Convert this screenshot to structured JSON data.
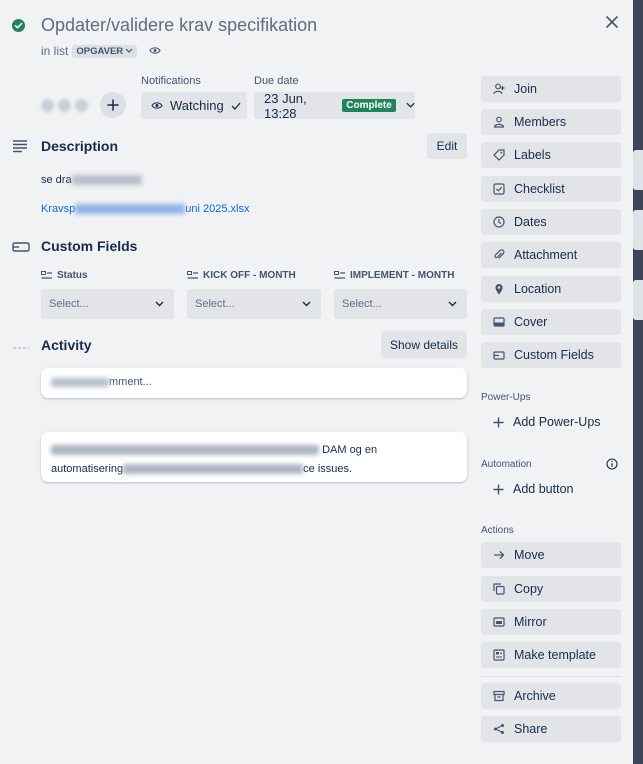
{
  "card": {
    "title": "Opdater/validere krav specifikation",
    "in_list_prefix": "in list",
    "list_name": "OPGAVER"
  },
  "labels": {
    "notifications": "Notifications",
    "due_date": "Due date"
  },
  "watch_label": "Watching",
  "due": {
    "value": "23 Jun, 13:28",
    "status": "Complete",
    "status_color": "#1f845a"
  },
  "description": {
    "heading": "Description",
    "edit_label": "Edit",
    "text": "se dra",
    "attachment_link": "Kravsp",
    "attachment_link_end": "uni 2025.xlsx"
  },
  "custom_fields": {
    "heading": "Custom Fields",
    "fields": [
      {
        "label": "Status",
        "placeholder": "Select..."
      },
      {
        "label": "KICK OFF - MONTH",
        "placeholder": "Select..."
      },
      {
        "label": "IMPLEMENT - MONTH",
        "placeholder": "Select..."
      }
    ]
  },
  "activity": {
    "heading": "Activity",
    "show_details_label": "Show details",
    "comment_placeholder": "mment...",
    "comment_line1_end": "DAM og en",
    "comment_line2_start": "automatisering",
    "comment_line2_end": "ce issues."
  },
  "sidebar": {
    "top": [
      {
        "label": "Join",
        "icon": "join-icon"
      },
      {
        "label": "Members",
        "icon": "person-icon"
      },
      {
        "label": "Labels",
        "icon": "tag-icon"
      },
      {
        "label": "Checklist",
        "icon": "checklist-icon"
      },
      {
        "label": "Dates",
        "icon": "clock-icon"
      },
      {
        "label": "Attachment",
        "icon": "paperclip-icon"
      },
      {
        "label": "Location",
        "icon": "pin-icon"
      },
      {
        "label": "Cover",
        "icon": "cover-icon"
      },
      {
        "label": "Custom Fields",
        "icon": "custom-fields-icon"
      }
    ],
    "powerups_heading": "Power-Ups",
    "add_powerups_label": "Add Power-Ups",
    "automation_heading": "Automation",
    "add_button_label": "Add button",
    "actions_heading": "Actions",
    "actions": [
      {
        "label": "Move",
        "icon": "arrow-right-icon"
      },
      {
        "label": "Copy",
        "icon": "copy-icon"
      },
      {
        "label": "Mirror",
        "icon": "mirror-icon"
      },
      {
        "label": "Make template",
        "icon": "template-icon"
      }
    ],
    "bottom": [
      {
        "label": "Archive",
        "icon": "archive-icon"
      },
      {
        "label": "Share",
        "icon": "share-icon"
      }
    ]
  }
}
